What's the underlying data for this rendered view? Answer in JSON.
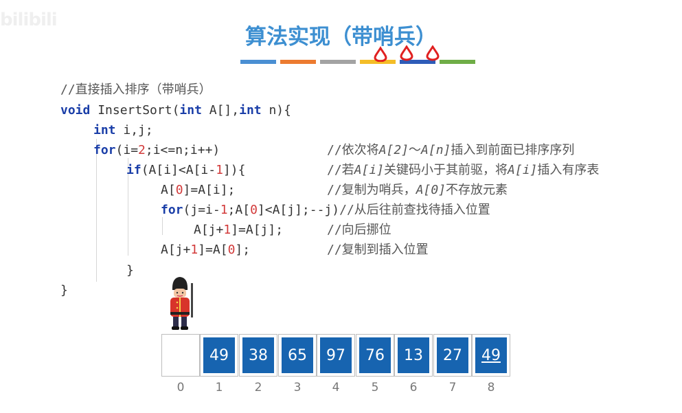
{
  "watermark": "bilibili",
  "title": "算法实现（带哨兵）",
  "stripe_colors": [
    "#4a8fd3",
    "#ec7b30",
    "#a3a3a3",
    "#f4bd27",
    "#2e5cb8",
    "#6fad47"
  ],
  "code": {
    "comment_head": "//直接插入排序（带哨兵）",
    "l1_kw": "void",
    "l1_rest": " InsertSort(",
    "l1_kw2": "int",
    "l1_rest2": " A[],",
    "l1_kw3": "int",
    "l1_rest3": " n){",
    "l2_kw": "int",
    "l2_rest": " i,j;",
    "l3_kw": "for",
    "l3_a": "(i=",
    "l3_num": "2",
    "l3_b": ";i<=n;i++)",
    "l3_cmt_a": "//依次将",
    "l3_cmt_i1": "A[2]",
    "l3_cmt_b": "～",
    "l3_cmt_i2": "A[n]",
    "l3_cmt_c": "插入到前面已排序序列",
    "l4_kw": "if",
    "l4_a": "(A[i]<A[i-",
    "l4_num": "1",
    "l4_b": "]){",
    "l4_cmt_a": "//若",
    "l4_cmt_i1": "A[i]",
    "l4_cmt_b": "关键码小于其前驱，将",
    "l4_cmt_i2": "A[i]",
    "l4_cmt_c": "插入有序表",
    "l5_a": "A[",
    "l5_num": "0",
    "l5_b": "]=A[i];",
    "l5_cmt_a": "//复制为哨兵，",
    "l5_cmt_i1": "A[0]",
    "l5_cmt_b": "不存放元素",
    "l6_kw": "for",
    "l6_a": "(j=i-",
    "l6_num": "1",
    "l6_b": ";A[",
    "l6_num2": "0",
    "l6_c": "]<A[j];--j)",
    "l6_cmt": "//从后往前查找待插入位置",
    "l7_a": "A[j+",
    "l7_num": "1",
    "l7_b": "]=A[j];",
    "l7_cmt": "//向后挪位",
    "l8_a": "A[j+",
    "l8_num": "1",
    "l8_b": "]=A[",
    "l8_num2": "0",
    "l8_c": "];",
    "l8_cmt": "//复制到插入位置",
    "l9": "}",
    "l10": "}"
  },
  "array": {
    "values": [
      "",
      "49",
      "38",
      "65",
      "97",
      "76",
      "13",
      "27",
      "49"
    ],
    "indices": [
      "0",
      "1",
      "2",
      "3",
      "4",
      "5",
      "6",
      "7",
      "8"
    ],
    "underlined_index": 8
  }
}
